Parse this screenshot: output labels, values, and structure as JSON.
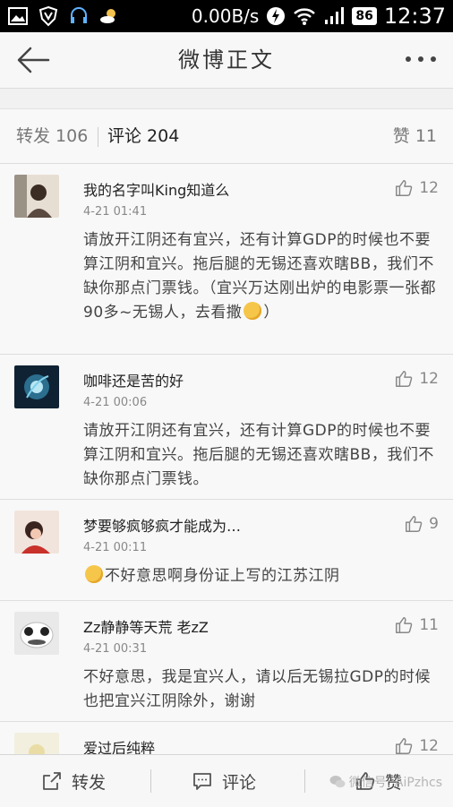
{
  "status_bar": {
    "speed": "0.00B/s",
    "battery": "86",
    "time": "12:37"
  },
  "header": {
    "title": "微博正文"
  },
  "tabs": {
    "repost": "转发 106",
    "comment": "评论 204",
    "like": "赞 11"
  },
  "comments": [
    {
      "username": "我的名字叫King知道么",
      "time": "4-21 01:41",
      "likes": "12",
      "text_before": "请放开江阴还有宜兴，还有计算GDP的时候也不要算江阴和宜兴。拖后腿的无锡还喜欢瞎BB，我们不缺你那点门票钱。（宜兴万达刚出炉的电影票一张都90多~无锡人，去看撒",
      "text_after": "）",
      "avatar_color": "#c8b8a6"
    },
    {
      "username": "咖啡还是苦的好",
      "time": "4-21 00:06",
      "likes": "12",
      "text": "请放开江阴还有宜兴，还有计算GDP的时候也不要算江阴和宜兴。拖后腿的无锡还喜欢瞎BB，我们不缺你那点门票钱。",
      "avatar_color": "#1d3a55"
    },
    {
      "username": "梦要够疯够疯才能成为…",
      "time": "4-21 00:11",
      "likes": "9",
      "text": "不好意思啊身份证上写的江苏江阴",
      "avatar_color": "#c97b6e"
    },
    {
      "username": "Zz静静等天荒 老zZ",
      "time": "4-21 00:31",
      "likes": "11",
      "text": "不好意思，我是宜兴人，请以后无锡拉GDP的时候也把宜兴江阴除外，谢谢",
      "avatar_color": "#d9d9d9"
    },
    {
      "username": "爱过后纯粹",
      "likes": "12",
      "avatar_color": "#e8e4cf"
    }
  ],
  "bottom_bar": {
    "repost": "转发",
    "comment": "评论",
    "like": "赞",
    "watermark": "微信号: AiPzhcs"
  }
}
